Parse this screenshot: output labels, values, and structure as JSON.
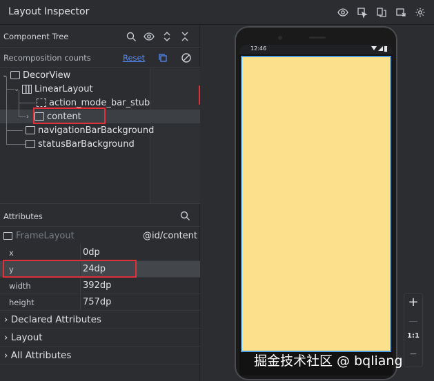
{
  "window": {
    "title": "Layout Inspector"
  },
  "toolbar": {
    "icons": [
      "eye-icon",
      "select-view-icon",
      "layer-icon",
      "snapshot-icon",
      "settings-icon"
    ]
  },
  "component_tree": {
    "label": "Component Tree",
    "icons": [
      "search-icon",
      "eye-icon",
      "expand-icon",
      "collapse-icon"
    ]
  },
  "recomposition": {
    "label": "Recomposition counts",
    "reset": "Reset"
  },
  "tree": {
    "nodes": [
      {
        "label": "DecorView"
      },
      {
        "label": "LinearLayout"
      },
      {
        "label": "action_mode_bar_stub"
      },
      {
        "label": "content"
      },
      {
        "label": "navigationBarBackground"
      },
      {
        "label": "statusBarBackground"
      }
    ]
  },
  "attributes": {
    "label": "Attributes",
    "view_class": "FrameLayout",
    "view_id": "@id/content",
    "rows": [
      {
        "key": "x",
        "value": "0dp"
      },
      {
        "key": "y",
        "value": "24dp"
      },
      {
        "key": "width",
        "value": "392dp"
      },
      {
        "key": "height",
        "value": "757dp"
      }
    ],
    "groups": [
      "Declared Attributes",
      "Layout",
      "All Attributes"
    ]
  },
  "device": {
    "status_time": "12:46"
  },
  "zoom": {
    "plus": "+",
    "minus": "−",
    "one_to_one": "1:1"
  },
  "watermark": "掘金技术社区 @ bqliang",
  "colors": {
    "accent": "#548af7",
    "highlight": "#e0303a",
    "content_fill": "#fde08c",
    "content_border": "#4b9be0"
  }
}
